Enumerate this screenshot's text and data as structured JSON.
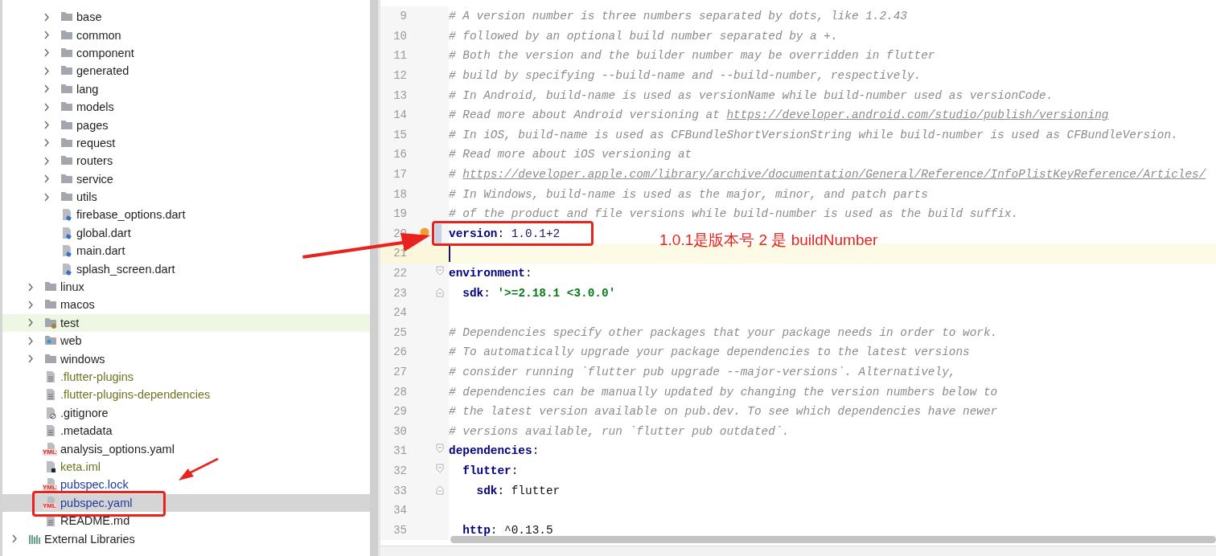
{
  "project_tree": {
    "items": [
      {
        "kind": "root",
        "children": [
          {
            "kind": "root",
            "children": [
              {
                "label": "base",
                "kind": "folder",
                "expanded": false,
                "selected": false,
                "color": "#1f1f1f"
              },
              {
                "label": "common",
                "kind": "folder",
                "expanded": false,
                "selected": false,
                "color": "#1f1f1f"
              },
              {
                "label": "component",
                "kind": "folder",
                "expanded": false,
                "selected": false,
                "color": "#1f1f1f"
              },
              {
                "label": "generated",
                "kind": "folder",
                "expanded": false,
                "selected": false,
                "color": "#1f1f1f"
              },
              {
                "label": "lang",
                "kind": "folder",
                "expanded": false,
                "selected": false,
                "color": "#1f1f1f"
              },
              {
                "label": "models",
                "kind": "folder",
                "expanded": false,
                "selected": false,
                "color": "#1f1f1f"
              },
              {
                "label": "pages",
                "kind": "folder",
                "expanded": false,
                "selected": false,
                "color": "#1f1f1f"
              },
              {
                "label": "request",
                "kind": "folder",
                "expanded": false,
                "selected": false,
                "color": "#1f1f1f"
              },
              {
                "label": "routers",
                "kind": "folder",
                "expanded": false,
                "selected": false,
                "color": "#1f1f1f"
              },
              {
                "label": "service",
                "kind": "folder",
                "expanded": false,
                "selected": false,
                "color": "#1f1f1f"
              },
              {
                "label": "utils",
                "kind": "folder",
                "expanded": false,
                "selected": false,
                "color": "#1f1f1f"
              },
              {
                "label": "firebase_options.dart",
                "kind": "dart",
                "selected": false,
                "color": "#1f1f1f"
              },
              {
                "label": "global.dart",
                "kind": "dart",
                "selected": false,
                "color": "#1f1f1f"
              },
              {
                "label": "main.dart",
                "kind": "dart",
                "selected": false,
                "color": "#1f1f1f"
              },
              {
                "label": "splash_screen.dart",
                "kind": "dart",
                "selected": false,
                "color": "#1f1f1f"
              }
            ]
          },
          {
            "label": "linux",
            "kind": "folder",
            "expanded": false,
            "selected": false,
            "color": "#1f1f1f"
          },
          {
            "label": "macos",
            "kind": "folder",
            "expanded": false,
            "selected": false,
            "color": "#1f1f1f"
          },
          {
            "label": "test",
            "kind": "test-folder",
            "expanded": false,
            "selected": false,
            "color": "#1f1f1f"
          },
          {
            "label": "web",
            "kind": "web-folder",
            "expanded": false,
            "selected": false,
            "color": "#1f1f1f"
          },
          {
            "label": "windows",
            "kind": "folder",
            "expanded": false,
            "selected": false,
            "color": "#1f1f1f"
          },
          {
            "label": ".flutter-plugins",
            "kind": "text",
            "selected": false,
            "color": "#6e7420"
          },
          {
            "label": ".flutter-plugins-dependencies",
            "kind": "text",
            "selected": false,
            "color": "#6e7420"
          },
          {
            "label": ".gitignore",
            "kind": "gitignore",
            "selected": false,
            "color": "#1f1f1f"
          },
          {
            "label": ".metadata",
            "kind": "text",
            "selected": false,
            "color": "#1f1f1f"
          },
          {
            "label": "analysis_options.yaml",
            "kind": "yaml",
            "badge": "YML",
            "selected": false,
            "color": "#1f1f1f"
          },
          {
            "label": "keta.iml",
            "kind": "iml",
            "selected": false,
            "color": "#6e7420"
          },
          {
            "label": "pubspec.lock",
            "kind": "yaml",
            "badge": "YML",
            "selected": false,
            "color": "#1f3aa0"
          },
          {
            "label": "pubspec.yaml",
            "kind": "yaml",
            "badge": "YML",
            "selected": true,
            "color": "#1f3aa0"
          },
          {
            "label": "README.md",
            "kind": "text",
            "selected": false,
            "color": "#1f1f1f"
          }
        ]
      },
      {
        "label": "External Libraries",
        "kind": "libraries",
        "expanded": false,
        "selected": false,
        "color": "#1f1f1f"
      }
    ]
  },
  "editor": {
    "lines": [
      {
        "number": "9",
        "current": false,
        "modified": false,
        "fold_start": false,
        "fold_end": false,
        "segments": [
          {
            "kind": "comment",
            "text": "# A version number is three numbers separated by dots, like 1.2.43"
          }
        ]
      },
      {
        "number": "10",
        "current": false,
        "modified": false,
        "fold_start": false,
        "fold_end": false,
        "segments": [
          {
            "kind": "comment",
            "text": "# followed by an optional build number separated by a +."
          }
        ]
      },
      {
        "number": "11",
        "current": false,
        "modified": false,
        "fold_start": false,
        "fold_end": false,
        "segments": [
          {
            "kind": "comment",
            "text": "# Both the version and the builder number may be overridden in flutter"
          }
        ]
      },
      {
        "number": "12",
        "current": false,
        "modified": false,
        "fold_start": false,
        "fold_end": false,
        "segments": [
          {
            "kind": "comment",
            "text": "# build by specifying --build-name and --build-number, respectively."
          }
        ]
      },
      {
        "number": "13",
        "current": false,
        "modified": false,
        "fold_start": false,
        "fold_end": false,
        "segments": [
          {
            "kind": "comment",
            "text": "# In Android, build-name is used as versionName while build-number used as versionCode."
          }
        ]
      },
      {
        "number": "14",
        "current": false,
        "modified": false,
        "fold_start": false,
        "fold_end": false,
        "segments": [
          {
            "kind": "comment",
            "text": "# Read more about Android versioning at "
          },
          {
            "kind": "link",
            "text": "https://developer.android.com/studio/publish/versioning"
          }
        ]
      },
      {
        "number": "15",
        "current": false,
        "modified": false,
        "fold_start": false,
        "fold_end": false,
        "segments": [
          {
            "kind": "comment",
            "text": "# In iOS, build-name is used as CFBundleShortVersionString while build-number is used as CFBundleVersion."
          }
        ]
      },
      {
        "number": "16",
        "current": false,
        "modified": false,
        "fold_start": false,
        "fold_end": false,
        "segments": [
          {
            "kind": "comment",
            "text": "# Read more about iOS versioning at"
          }
        ]
      },
      {
        "number": "17",
        "current": false,
        "modified": false,
        "fold_start": false,
        "fold_end": false,
        "segments": [
          {
            "kind": "comment",
            "text": "# "
          },
          {
            "kind": "link",
            "text": "https://developer.apple.com/library/archive/documentation/General/Reference/InfoPlistKeyReference/Articles/"
          }
        ]
      },
      {
        "number": "18",
        "current": false,
        "modified": false,
        "fold_start": false,
        "fold_end": false,
        "segments": [
          {
            "kind": "comment",
            "text": "# In Windows, build-name is used as the major, minor, and patch parts"
          }
        ]
      },
      {
        "number": "19",
        "current": false,
        "modified": false,
        "fold_start": false,
        "fold_end": false,
        "segments": [
          {
            "kind": "comment",
            "text": "# of the product and file versions while build-number is used as the build suffix."
          }
        ]
      },
      {
        "number": "20",
        "current": false,
        "modified": true,
        "fold_start": false,
        "fold_end": false,
        "bulb": true,
        "segments": [
          {
            "kind": "key",
            "text": "version"
          },
          {
            "kind": "plain",
            "text": ": "
          },
          {
            "kind": "value",
            "text": "1.0.1+2"
          }
        ]
      },
      {
        "number": "21",
        "current": true,
        "modified": false,
        "fold_start": false,
        "fold_end": false
      },
      {
        "number": "22",
        "current": false,
        "modified": false,
        "fold_start": true,
        "fold_end": false,
        "segments": [
          {
            "kind": "key",
            "text": "environment"
          },
          {
            "kind": "plain",
            "text": ":"
          }
        ]
      },
      {
        "number": "23",
        "current": false,
        "modified": false,
        "fold_start": false,
        "fold_end": true,
        "segments": [
          {
            "kind": "key",
            "text": "  sdk"
          },
          {
            "kind": "plain",
            "text": ": "
          },
          {
            "kind": "string",
            "text": "'>=2.18.1 <3.0.0'"
          }
        ]
      },
      {
        "number": "24",
        "current": false,
        "modified": false,
        "fold_start": false,
        "fold_end": false
      },
      {
        "number": "25",
        "current": false,
        "modified": false,
        "fold_start": false,
        "fold_end": false,
        "segments": [
          {
            "kind": "comment",
            "text": "# Dependencies specify other packages that your package needs in order to work."
          }
        ]
      },
      {
        "number": "26",
        "current": false,
        "modified": false,
        "fold_start": false,
        "fold_end": false,
        "segments": [
          {
            "kind": "comment",
            "text": "# To automatically upgrade your package dependencies to the latest versions"
          }
        ]
      },
      {
        "number": "27",
        "current": false,
        "modified": false,
        "fold_start": false,
        "fold_end": false,
        "segments": [
          {
            "kind": "comment",
            "text": "# consider running `flutter pub upgrade --major-versions`. Alternatively,"
          }
        ]
      },
      {
        "number": "28",
        "current": false,
        "modified": false,
        "fold_start": false,
        "fold_end": false,
        "segments": [
          {
            "kind": "comment",
            "text": "# dependencies can be manually updated by changing the version numbers below to"
          }
        ]
      },
      {
        "number": "29",
        "current": false,
        "modified": false,
        "fold_start": false,
        "fold_end": false,
        "segments": [
          {
            "kind": "comment",
            "text": "# the latest version available on pub.dev. To see which dependencies have newer"
          }
        ]
      },
      {
        "number": "30",
        "current": false,
        "modified": false,
        "fold_start": false,
        "fold_end": false,
        "segments": [
          {
            "kind": "comment",
            "text": "# versions available, run `flutter pub outdated`."
          }
        ]
      },
      {
        "number": "31",
        "current": false,
        "modified": false,
        "fold_start": true,
        "fold_end": false,
        "segments": [
          {
            "kind": "key",
            "text": "dependencies"
          },
          {
            "kind": "plain",
            "text": ":"
          }
        ]
      },
      {
        "number": "32",
        "current": false,
        "modified": false,
        "fold_start": true,
        "fold_end": false,
        "segments": [
          {
            "kind": "key",
            "text": "  flutter"
          },
          {
            "kind": "plain",
            "text": ":"
          }
        ]
      },
      {
        "number": "33",
        "current": false,
        "modified": false,
        "fold_start": false,
        "fold_end": true,
        "segments": [
          {
            "kind": "key",
            "text": "    sdk"
          },
          {
            "kind": "plain",
            "text": ": flutter"
          }
        ]
      },
      {
        "number": "34",
        "current": false,
        "modified": false,
        "fold_start": false,
        "fold_end": false
      },
      {
        "number": "35",
        "current": false,
        "modified": false,
        "fold_start": false,
        "fold_end": false,
        "segments": [
          {
            "kind": "key",
            "text": "  http"
          },
          {
            "kind": "plain",
            "text": ": ^0.13.5"
          }
        ]
      }
    ]
  },
  "annotation": {
    "callout": "1.0.1是版本号 2 是 buildNumber"
  }
}
